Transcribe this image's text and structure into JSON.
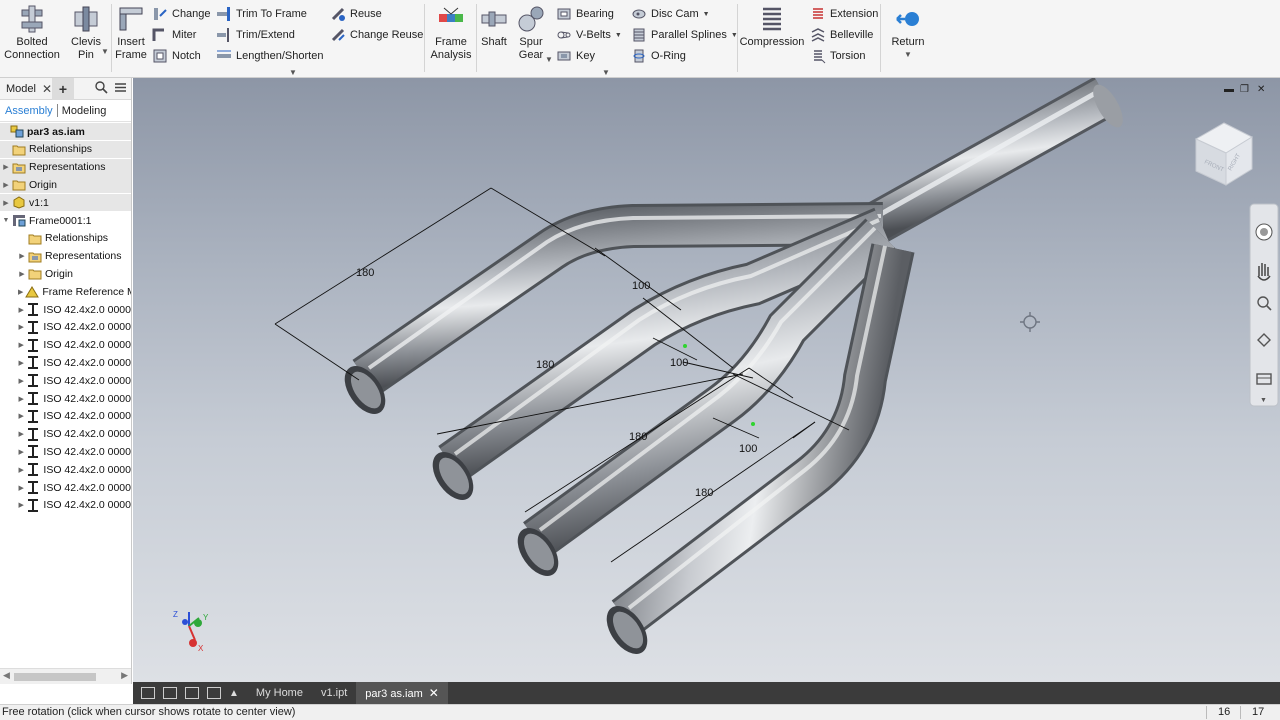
{
  "ribbon": {
    "bolted_connection": "Bolted\nConnection",
    "clevis_pin": "Clevis\nPin",
    "insert_frame": "Insert\nFrame",
    "change": "Change",
    "miter": "Miter",
    "notch": "Notch",
    "trim_to_frame": "Trim To Frame",
    "trim_extend": "Trim/Extend",
    "lengthen_shorten": "Lengthen/Shorten",
    "reuse": "Reuse",
    "change_reuse": "Change Reuse",
    "frame_analysis": "Frame\nAnalysis",
    "shaft": "Shaft",
    "spur_gear": "Spur\nGear",
    "bearing": "Bearing",
    "v_belts": "V-Belts",
    "key": "Key",
    "disc_cam": "Disc Cam",
    "parallel_splines": "Parallel Splines",
    "o_ring": "O-Ring",
    "compression": "Compression",
    "extension": "Extension",
    "belleville": "Belleville",
    "torsion": "Torsion",
    "return": "Return"
  },
  "browser": {
    "tab_model": "Model",
    "subtab_assembly": "Assembly",
    "subtab_modeling": "Modeling",
    "tree": [
      {
        "label": "par3 as.iam",
        "level": 0,
        "icon": "assembly-icon",
        "bold": true,
        "hl": true,
        "expander": ""
      },
      {
        "label": "Relationships",
        "level": 1,
        "icon": "folder-icon",
        "hl": true,
        "expander": ""
      },
      {
        "label": "Representations",
        "level": 1,
        "icon": "representations-icon",
        "hl": true,
        "expander": "▶"
      },
      {
        "label": "Origin",
        "level": 1,
        "icon": "folder-icon",
        "hl": true,
        "expander": "▶"
      },
      {
        "label": "v1:1",
        "level": 1,
        "icon": "part-icon",
        "hl": true,
        "expander": "▶"
      },
      {
        "label": "Frame0001:1",
        "level": 1,
        "icon": "frame-assembly-icon",
        "expander": "▼"
      },
      {
        "label": "Relationships",
        "level": 2,
        "icon": "folder-icon",
        "expander": ""
      },
      {
        "label": "Representations",
        "level": 2,
        "icon": "representations-icon",
        "expander": "▶"
      },
      {
        "label": "Origin",
        "level": 2,
        "icon": "folder-icon",
        "expander": "▶"
      },
      {
        "label": "Frame Reference M",
        "level": 2,
        "icon": "frame-reference-icon",
        "expander": "▶"
      },
      {
        "label": "ISO 42.4x2.0 0000",
        "level": 2,
        "icon": "ibeam-icon",
        "expander": "▶"
      },
      {
        "label": "ISO 42.4x2.0 0000",
        "level": 2,
        "icon": "ibeam-icon",
        "expander": "▶"
      },
      {
        "label": "ISO 42.4x2.0 0000",
        "level": 2,
        "icon": "ibeam-icon",
        "expander": "▶"
      },
      {
        "label": "ISO 42.4x2.0 0000",
        "level": 2,
        "icon": "ibeam-icon",
        "expander": "▶"
      },
      {
        "label": "ISO 42.4x2.0 0000",
        "level": 2,
        "icon": "ibeam-icon",
        "expander": "▶"
      },
      {
        "label": "ISO 42.4x2.0 0000",
        "level": 2,
        "icon": "ibeam-icon",
        "expander": "▶"
      },
      {
        "label": "ISO 42.4x2.0 0000",
        "level": 2,
        "icon": "ibeam-icon",
        "expander": "▶"
      },
      {
        "label": "ISO 42.4x2.0 0000",
        "level": 2,
        "icon": "ibeam-icon",
        "expander": "▶"
      },
      {
        "label": "ISO 42.4x2.0 0000",
        "level": 2,
        "icon": "ibeam-icon",
        "expander": "▶"
      },
      {
        "label": "ISO 42.4x2.0 0000",
        "level": 2,
        "icon": "ibeam-icon",
        "expander": "▶"
      },
      {
        "label": "ISO 42.4x2.0 0000",
        "level": 2,
        "icon": "ibeam-icon",
        "expander": "▶"
      },
      {
        "label": "ISO 42.4x2.0 0000",
        "level": 2,
        "icon": "ibeam-icon",
        "expander": "▶"
      }
    ]
  },
  "viewport": {
    "dimensions": [
      "180",
      "100",
      "180",
      "100",
      "180",
      "100",
      "180"
    ],
    "viewcube_faces": [
      "FRONT",
      "RIGHT"
    ],
    "triad_labels": [
      "Z",
      "Y",
      "X"
    ]
  },
  "doctabs": {
    "tabs": [
      "My Home",
      "v1.ipt",
      "par3 as.iam"
    ],
    "active": "par3 as.iam"
  },
  "status": {
    "message": "Free rotation (click when cursor shows rotate to center view)",
    "count1": "16",
    "count2": "17"
  },
  "colors": {
    "viewport_top": "#8d96a6",
    "viewport_bottom": "#dde0e5",
    "accent": "#2a7fd4",
    "tab_bar": "#3b3b3b"
  }
}
